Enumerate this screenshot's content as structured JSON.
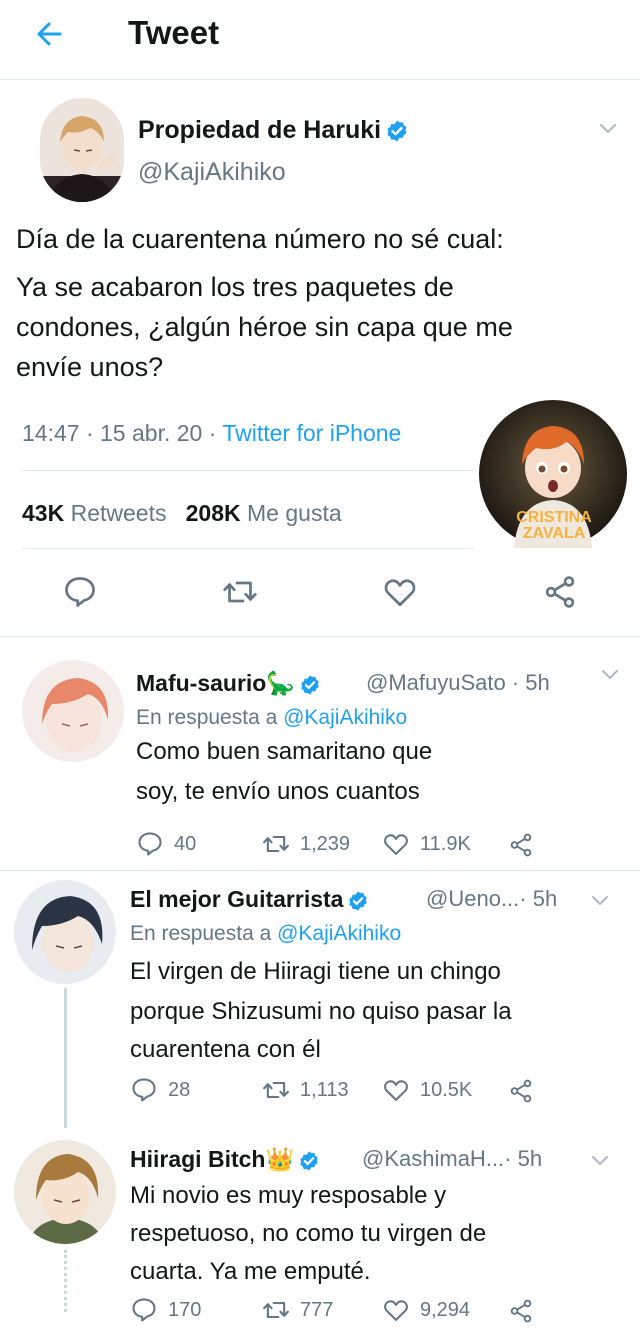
{
  "header": {
    "title": "Tweet"
  },
  "main_tweet": {
    "name": "Propiedad de Haruki",
    "handle": "@KajiAkihiko",
    "lines": [
      "Día de la cuarentena número no sé cual:",
      "Ya se acabaron los tres paquetes de",
      "condones, ¿algún héroe sin capa que me",
      "envíe unos?"
    ],
    "time": "14:47",
    "date": "15 abr. 20",
    "source": "Twitter for iPhone",
    "retweets_count": "43K",
    "retweets_label": "Retweets",
    "likes_count": "208K",
    "likes_label": "Me gusta"
  },
  "watermark": {
    "line1": "CRISTINA",
    "line2": "ZAVALA"
  },
  "replies": [
    {
      "name": "Mafu-saurio🦕",
      "handle": "@MafuyuSato",
      "time": "· 5h",
      "reply_prefix": "En respuesta a",
      "reply_to": "@KajiAkihiko",
      "lines": [
        "Como buen samaritano que",
        "soy, te envío unos cuantos"
      ],
      "replies": "40",
      "retweets": "1,239",
      "likes": "11.9K"
    },
    {
      "name": "El mejor Guitarrista",
      "handle": "@Ueno...",
      "time": "· 5h",
      "reply_prefix": "En respuesta a",
      "reply_to": "@KajiAkihiko",
      "lines": [
        "El virgen de Hiiragi tiene un chingo",
        "porque Shizusumi no quiso pasar la",
        "cuarentena con él"
      ],
      "replies": "28",
      "retweets": "1,113",
      "likes": "10.5K"
    },
    {
      "name": "Hiiragi Bitch👑",
      "handle": "@KashimaH...",
      "time": "· 5h",
      "lines": [
        "Mi novio es muy resposable y",
        "respetuoso, no como tu virgen de",
        "cuarta. Ya me emputé."
      ],
      "replies": "170",
      "retweets": "777",
      "likes": "9,294"
    }
  ],
  "colors": {
    "accent": "#1da1f2",
    "text": "#14171a",
    "muted": "#657786",
    "border": "#e1e8ed"
  },
  "icons": [
    "back-arrow-icon",
    "verified-badge-icon",
    "chevron-down-icon",
    "reply-icon",
    "retweet-icon",
    "like-icon",
    "share-icon"
  ]
}
